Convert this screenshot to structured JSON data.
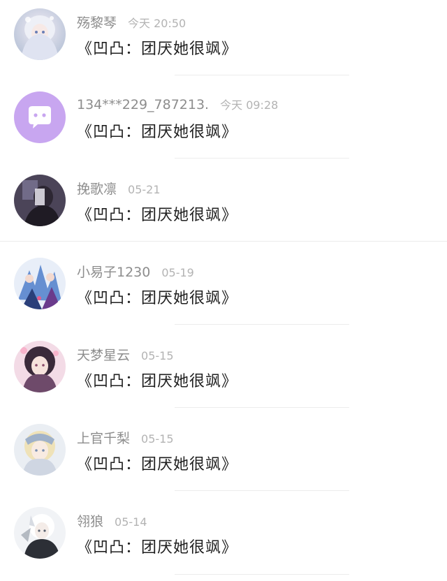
{
  "comments": [
    {
      "user": "殇黎琴",
      "time": "今天 20:50",
      "text": "《凹凸：团厌她很飒》",
      "avatar": "anime-girl-white-hair-avatar"
    },
    {
      "user": "134***229_787213.",
      "time": "今天 09:28",
      "text": "《凹凸：团厌她很飒》",
      "avatar": "default-chat-bubble-avatar"
    },
    {
      "user": "挽歌凛",
      "time": "05-21",
      "text": "《凹凸：团厌她很飒》",
      "avatar": "dark-figure-avatar"
    },
    {
      "user": "小易子1230",
      "time": "05-19",
      "text": "《凹凸：团厌她很飒》",
      "avatar": "blue-anime-characters-avatar"
    },
    {
      "user": "天梦星云",
      "time": "05-15",
      "text": "《凹凸：团厌她很飒》",
      "avatar": "pink-anime-girl-avatar"
    },
    {
      "user": "上官千梨",
      "time": "05-15",
      "text": "《凹凸：团厌她很飒》",
      "avatar": "blonde-anime-girl-avatar"
    },
    {
      "user": "翎狼",
      "time": "05-14",
      "text": "《凹凸：团厌她很飒》",
      "avatar": "white-hair-anime-boy-avatar"
    }
  ],
  "colors": {
    "default_avatar_bg": "#c8a6f0",
    "username": "#8d8d8d",
    "timestamp": "#b3b3b3",
    "message": "#1f1f1f"
  }
}
